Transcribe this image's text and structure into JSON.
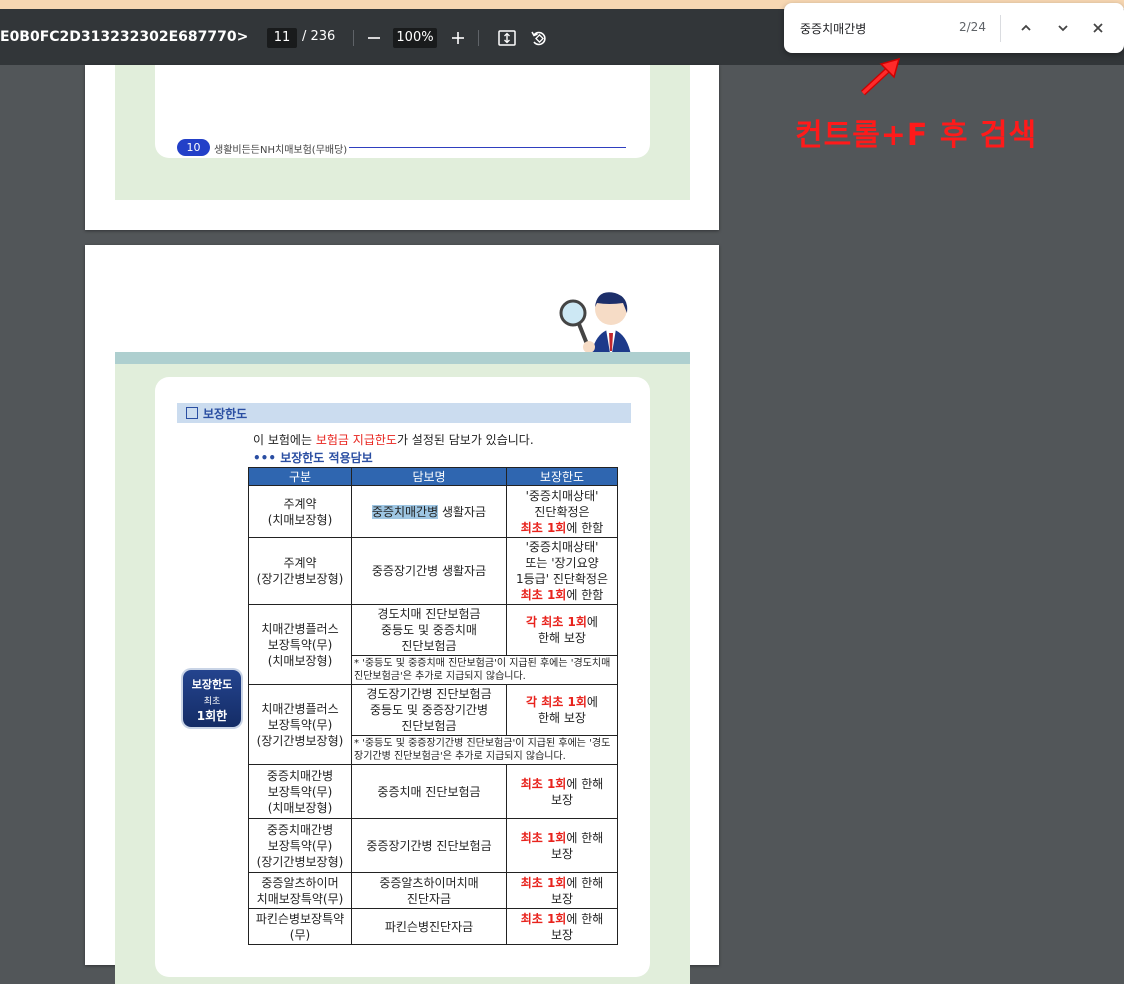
{
  "toolbar": {
    "doc_title": "E0B0FC2D313232302E687770>",
    "page_current": "11",
    "page_total": "/ 236",
    "zoom": "100%",
    "icons": [
      "minus-icon",
      "plus-icon",
      "fit-page-icon",
      "rotate-icon"
    ]
  },
  "findbar": {
    "query": "중증치매간병",
    "count": "2/24",
    "icons": [
      "chevron-up-icon",
      "chevron-down-icon",
      "close-icon"
    ]
  },
  "annotation": {
    "text": "컨트롤+F 후 검색",
    "color": "#ff1a1a"
  },
  "page_prev": {
    "page_number": "10",
    "footer_text": "생활비든든NH치매보험(무배당)"
  },
  "page_curr": {
    "section_title": "보장한도",
    "intro": {
      "before": "이 보험에는 ",
      "highlight": "보험금 지급한도",
      "after": "가 설정된 담보가 있습니다."
    },
    "sub_title": "••• 보장한도 적용담보",
    "badge": {
      "title": "보장한도",
      "sub": "최초",
      "count": "1회한"
    },
    "table": {
      "headers": [
        "구분",
        "담보명",
        "보장한도"
      ],
      "rows": [
        {
          "cat": "주계약\n(치매보장형)",
          "name_hl": "중증치매간병",
          "name_rest": " 생활자금",
          "limit_text": "'중증치매상태'\n진단확정은",
          "limit_red": "최초 1회",
          "limit_after": "에 한함"
        },
        {
          "cat": "주계약\n(장기간병보장형)",
          "name_hl": "",
          "name_rest": "중증장기간병 생활자금",
          "limit_text": "'중증치매상태'\n또는 '장기요양\n1등급' 진단확정은",
          "limit_red": "최초 1회",
          "limit_after": "에 한함"
        },
        {
          "cat": "치매간병플러스\n보장특약(무)\n(치매보장형)",
          "name_hl": "",
          "name_rest": "경도치매 진단보험금\n중등도 및 중증치매\n진단보험금",
          "limit_text": "",
          "limit_red": "각 최초 1회",
          "limit_after": "에\n한해 보장",
          "note": "* '중등도 및 중증치매 진단보험금'이 지급된 후에는 '경도치매 진단보험금'은 추가로 지급되지 않습니다."
        },
        {
          "cat": "치매간병플러스\n보장특약(무)\n(장기간병보장형)",
          "name_hl": "",
          "name_rest": "경도장기간병 진단보험금\n중등도 및 중증장기간병\n진단보험금",
          "limit_text": "",
          "limit_red": "각 최초 1회",
          "limit_after": "에\n한해 보장",
          "note": "* '중등도 및 중증장기간병 진단보험금'이 지급된 후에는 '경도장기간병 진단보험금'은 추가로 지급되지 않습니다."
        },
        {
          "cat": "중증치매간병\n보장특약(무)\n(치매보장형)",
          "name_hl": "",
          "name_rest": "중증치매 진단보험금",
          "limit_text": "",
          "limit_red": "최초 1회",
          "limit_after": "에 한해\n보장"
        },
        {
          "cat": "중증치매간병\n보장특약(무)\n(장기간병보장형)",
          "name_hl": "",
          "name_rest": "중증장기간병 진단보험금",
          "limit_text": "",
          "limit_red": "최초 1회",
          "limit_after": "에 한해\n보장"
        },
        {
          "cat": "중증알츠하이머\n치매보장특약(무)",
          "name_hl": "",
          "name_rest": "중증알츠하이머치매\n진단자금",
          "limit_text": "",
          "limit_red": "최초 1회",
          "limit_after": "에 한해\n보장"
        },
        {
          "cat": "파킨슨병보장특약\n(무)",
          "name_hl": "",
          "name_rest": "파킨슨병진단자금",
          "limit_text": "",
          "limit_red": "최초 1회",
          "limit_after": "에 한해\n보장"
        }
      ]
    }
  }
}
